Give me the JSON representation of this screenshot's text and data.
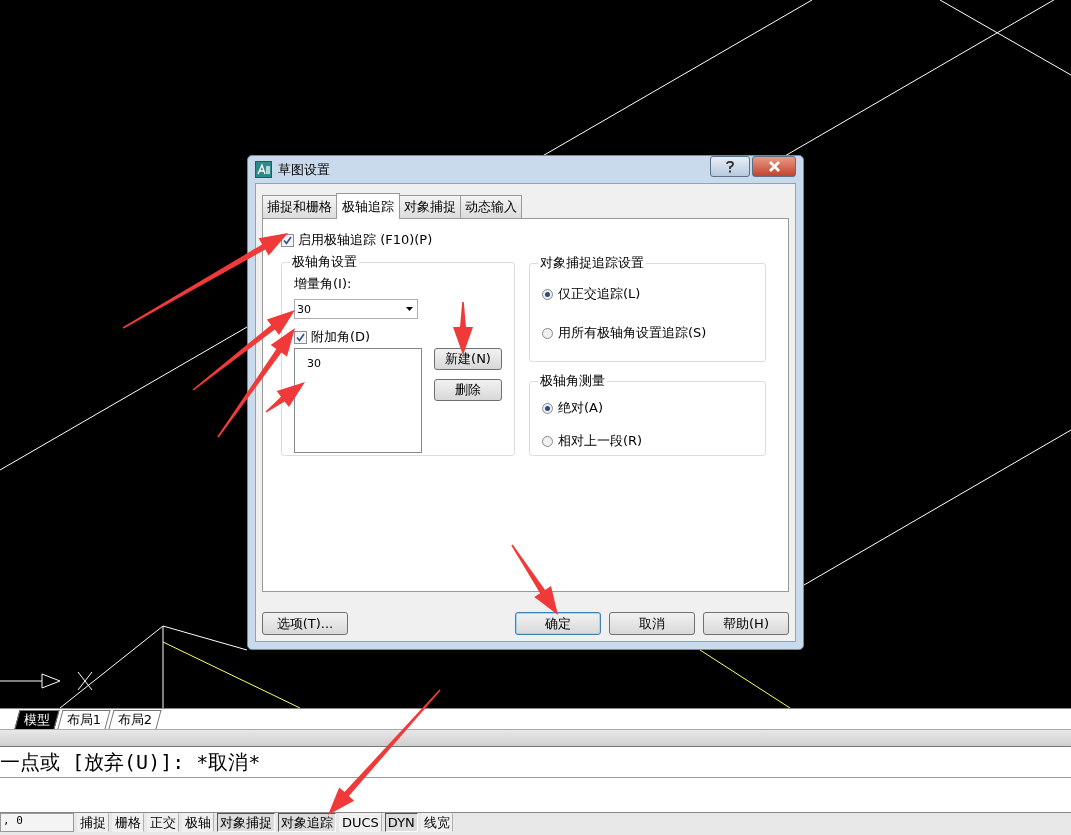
{
  "window": {
    "title": "草图设置"
  },
  "tabs": [
    {
      "label": "捕捉和栅格",
      "selected": false
    },
    {
      "label": "极轴追踪",
      "selected": true
    },
    {
      "label": "对象捕捉",
      "selected": false
    },
    {
      "label": "动态输入",
      "selected": false
    }
  ],
  "enable_polar": {
    "label": "启用极轴追踪 (F10)(P)",
    "checked": true
  },
  "polar_angle_settings": {
    "title": "极轴角设置",
    "increment": {
      "label": "增量角(I):",
      "value": "30"
    },
    "additional": {
      "label": "附加角(D)",
      "checked": true
    },
    "angles": [
      "30"
    ],
    "buttons": [
      "新建(N)",
      "删除"
    ]
  },
  "object_snap_tracking": {
    "title": "对象捕捉追踪设置",
    "options": [
      {
        "label": "仅正交追踪(L)",
        "selected": true
      },
      {
        "label": "用所有极轴角设置追踪(S)",
        "selected": false
      }
    ]
  },
  "polar_measurement": {
    "title": "极轴角测量",
    "options": [
      {
        "label": "绝对(A)",
        "selected": true
      },
      {
        "label": "相对上一段(R)",
        "selected": false
      }
    ]
  },
  "footer_buttons": [
    {
      "label": "选项(T)...",
      "default": false
    },
    {
      "label": "确定",
      "default": true
    },
    {
      "label": "取消",
      "default": false
    },
    {
      "label": "帮助(H)",
      "default": false
    }
  ],
  "layout_tabs": [
    {
      "label": "模型",
      "selected": true
    },
    {
      "label": "布局1",
      "selected": false
    },
    {
      "label": "布局2",
      "selected": false
    }
  ],
  "command_line": "一点或 [放弃(U)]: *取消*",
  "status_bar": {
    "coordinates": ", 0",
    "toggles": [
      {
        "label": "捕捉",
        "on": false
      },
      {
        "label": "栅格",
        "on": false
      },
      {
        "label": "正交",
        "on": false
      },
      {
        "label": "极轴",
        "on": false
      },
      {
        "label": "对象捕捉",
        "on": true
      },
      {
        "label": "对象追踪",
        "on": true
      },
      {
        "label": "DUCS",
        "on": false
      },
      {
        "label": "DYN",
        "on": true
      },
      {
        "label": "线宽",
        "on": false
      }
    ]
  }
}
